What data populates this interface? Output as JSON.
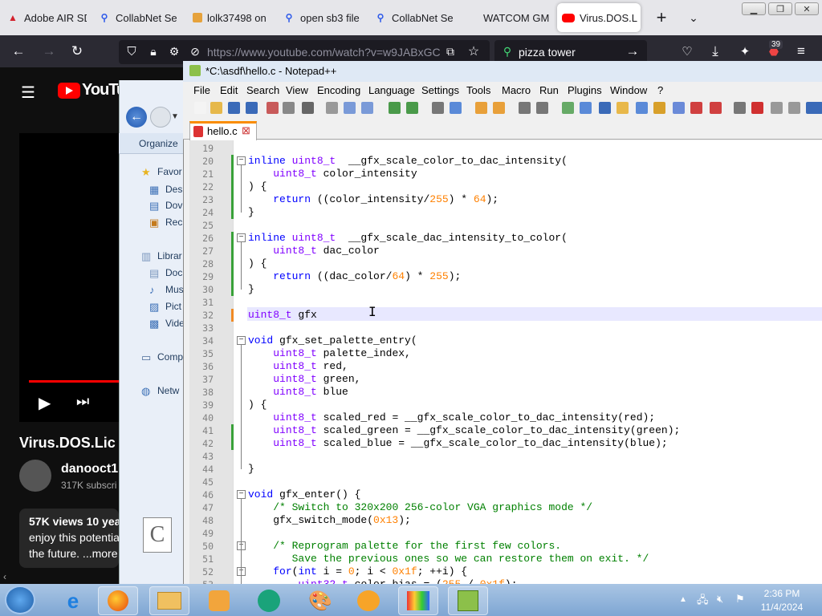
{
  "browser": {
    "tabs": [
      {
        "title": "Adobe AIR SD",
        "icon": "adobe-icon",
        "color": "#d3212d"
      },
      {
        "title": "CollabNet Se",
        "icon": "search-icon",
        "color": "#2f5bea"
      },
      {
        "title": "lolk37498 on",
        "icon": "folder-icon",
        "color": "#e6a23c"
      },
      {
        "title": "open sb3 file",
        "icon": "search-icon",
        "color": "#2f5bea"
      },
      {
        "title": "CollabNet Se",
        "icon": "search-icon",
        "color": "#2f5bea"
      },
      {
        "title": "WATCOM GML",
        "icon": "",
        "color": ""
      },
      {
        "title": "Virus.DOS.L",
        "icon": "youtube-icon",
        "color": "#ff0000"
      }
    ],
    "new_tab_label": "+",
    "url": "https://www.youtube.com/watch?v=w9JABxGC",
    "search_text": "pizza tower",
    "notification_count": "39"
  },
  "youtube": {
    "logo": "YouTu",
    "video_title": "Virus.DOS.Lic",
    "channel": "danooct1",
    "subscribers": "317K subscri",
    "views": "57K views  10 yea",
    "desc1": "enjoy this potentia",
    "desc2": "the future. ...more"
  },
  "explorer": {
    "organize": "Organize",
    "items": [
      "Favor",
      "Des",
      "Dov",
      "Rec",
      "Librar",
      "Doc",
      "Mus",
      "Pict",
      "Vide",
      "Comp",
      "Netw"
    ]
  },
  "notepad": {
    "title": "*C:\\asdf\\hello.c - Notepad++",
    "menu": [
      "File",
      "Edit",
      "Search",
      "View",
      "Encoding",
      "Language",
      "Settings",
      "Tools",
      "Macro",
      "Run",
      "Plugins",
      "Window",
      "?"
    ],
    "file_tab": "hello.c",
    "lines": [
      {
        "n": "19",
        "segs": []
      },
      {
        "n": "20",
        "segs": [
          [
            "kw",
            "inline "
          ],
          [
            "ty",
            "uint8_t"
          ],
          [
            "",
            "  __gfx_scale_color_to_dac_intensity("
          ]
        ]
      },
      {
        "n": "21",
        "segs": [
          [
            "",
            "    "
          ],
          [
            "ty",
            "uint8_t"
          ],
          [
            "",
            " color_intensity"
          ]
        ]
      },
      {
        "n": "22",
        "segs": [
          [
            "",
            ") {"
          ]
        ]
      },
      {
        "n": "23",
        "segs": [
          [
            "",
            "    "
          ],
          [
            "kw",
            "return"
          ],
          [
            "",
            " ((color_intensity/"
          ],
          [
            "nm",
            "255"
          ],
          [
            "",
            ") * "
          ],
          [
            "nm",
            "64"
          ],
          [
            "",
            ");"
          ]
        ]
      },
      {
        "n": "24",
        "segs": [
          [
            "",
            "}"
          ]
        ]
      },
      {
        "n": "25",
        "segs": []
      },
      {
        "n": "26",
        "segs": [
          [
            "kw",
            "inline "
          ],
          [
            "ty",
            "uint8_t"
          ],
          [
            "",
            "  __gfx_scale_dac_intensity_to_color("
          ]
        ]
      },
      {
        "n": "27",
        "segs": [
          [
            "",
            "    "
          ],
          [
            "ty",
            "uint8_t"
          ],
          [
            "",
            " dac_color"
          ]
        ]
      },
      {
        "n": "28",
        "segs": [
          [
            "",
            ") {"
          ]
        ]
      },
      {
        "n": "29",
        "segs": [
          [
            "",
            "    "
          ],
          [
            "kw",
            "return"
          ],
          [
            "",
            " ((dac_color/"
          ],
          [
            "nm",
            "64"
          ],
          [
            "",
            ") * "
          ],
          [
            "nm",
            "255"
          ],
          [
            "",
            ");"
          ]
        ]
      },
      {
        "n": "30",
        "segs": [
          [
            "",
            "}"
          ]
        ]
      },
      {
        "n": "31",
        "segs": []
      },
      {
        "n": "32",
        "segs": [
          [
            "ty",
            "uint8_t"
          ],
          [
            "",
            " gfx"
          ]
        ]
      },
      {
        "n": "33",
        "segs": []
      },
      {
        "n": "34",
        "segs": [
          [
            "kw",
            "void"
          ],
          [
            "",
            " gfx_set_palette_entry("
          ]
        ]
      },
      {
        "n": "35",
        "segs": [
          [
            "",
            "    "
          ],
          [
            "ty",
            "uint8_t"
          ],
          [
            "",
            " palette_index,"
          ]
        ]
      },
      {
        "n": "36",
        "segs": [
          [
            "",
            "    "
          ],
          [
            "ty",
            "uint8_t"
          ],
          [
            "",
            " red,"
          ]
        ]
      },
      {
        "n": "37",
        "segs": [
          [
            "",
            "    "
          ],
          [
            "ty",
            "uint8_t"
          ],
          [
            "",
            " green,"
          ]
        ]
      },
      {
        "n": "38",
        "segs": [
          [
            "",
            "    "
          ],
          [
            "ty",
            "uint8_t"
          ],
          [
            "",
            " blue"
          ]
        ]
      },
      {
        "n": "39",
        "segs": [
          [
            "",
            ") {"
          ]
        ]
      },
      {
        "n": "40",
        "segs": [
          [
            "",
            "    "
          ],
          [
            "ty",
            "uint8_t"
          ],
          [
            "",
            " scaled_red = __gfx_scale_color_to_dac_intensity(red);"
          ]
        ]
      },
      {
        "n": "41",
        "segs": [
          [
            "",
            "    "
          ],
          [
            "ty",
            "uint8_t"
          ],
          [
            "",
            " scaled_green = __gfx_scale_color_to_dac_intensity(green);"
          ]
        ]
      },
      {
        "n": "42",
        "segs": [
          [
            "",
            "    "
          ],
          [
            "ty",
            "uint8_t"
          ],
          [
            "",
            " scaled_blue = __gfx_scale_color_to_dac_intensity(blue);"
          ]
        ]
      },
      {
        "n": "43",
        "segs": []
      },
      {
        "n": "44",
        "segs": [
          [
            "",
            "}"
          ]
        ]
      },
      {
        "n": "45",
        "segs": []
      },
      {
        "n": "46",
        "segs": [
          [
            "kw",
            "void"
          ],
          [
            "",
            " gfx_enter() {"
          ]
        ]
      },
      {
        "n": "47",
        "segs": [
          [
            "",
            "    "
          ],
          [
            "cm",
            "/* Switch to 320x200 256-color VGA graphics mode */"
          ]
        ]
      },
      {
        "n": "48",
        "segs": [
          [
            "",
            "    gfx_switch_mode("
          ],
          [
            "nm",
            "0x13"
          ],
          [
            "",
            ");"
          ]
        ]
      },
      {
        "n": "49",
        "segs": []
      },
      {
        "n": "50",
        "segs": [
          [
            "",
            "    "
          ],
          [
            "cm",
            "/* Reprogram palette for the first few colors."
          ]
        ]
      },
      {
        "n": "51",
        "segs": [
          [
            "cm",
            "       Save the previous ones so we can restore them on exit. */"
          ]
        ]
      },
      {
        "n": "52",
        "segs": [
          [
            "",
            "    "
          ],
          [
            "kw",
            "for"
          ],
          [
            "",
            "("
          ],
          [
            "kw",
            "int"
          ],
          [
            "",
            " i = "
          ],
          [
            "nm",
            "0"
          ],
          [
            "",
            "; i < "
          ],
          [
            "nm",
            "0x1f"
          ],
          [
            "",
            "; ++i) {"
          ]
        ]
      },
      {
        "n": "53",
        "segs": [
          [
            "",
            "        "
          ],
          [
            "ty",
            "uint32_t"
          ],
          [
            "",
            " color_bias = ("
          ],
          [
            "nm",
            "255"
          ],
          [
            "",
            " / "
          ],
          [
            "nm",
            "0x1f"
          ],
          [
            "",
            ");"
          ]
        ]
      }
    ]
  },
  "taskbar": {
    "time": "2:36 PM",
    "date": "11/4/2024"
  }
}
